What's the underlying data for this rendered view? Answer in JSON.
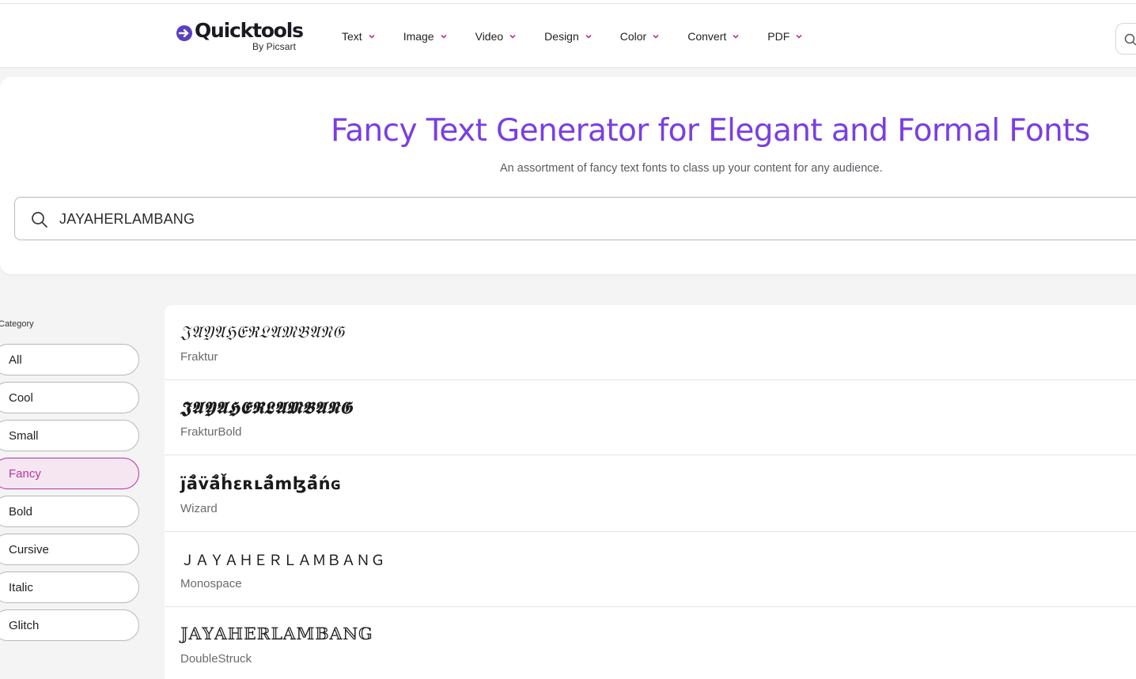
{
  "brand": {
    "name": "Quicktools",
    "sub": "By Picsart",
    "accent": "#7a3ee3",
    "active_color": "#b6349b"
  },
  "nav": {
    "items": [
      {
        "label": "Text"
      },
      {
        "label": "Image"
      },
      {
        "label": "Video"
      },
      {
        "label": "Design"
      },
      {
        "label": "Color"
      },
      {
        "label": "Convert"
      },
      {
        "label": "PDF"
      }
    ]
  },
  "hero": {
    "title": "Fancy Text Generator for Elegant and Formal Fonts",
    "subtitle": "An assortment of fancy text fonts to class up your content for any audience."
  },
  "search": {
    "value": "JAYAHERLAMBANG",
    "icon": "search-icon"
  },
  "categories": {
    "label": "Category",
    "items": [
      {
        "label": "All",
        "active": false
      },
      {
        "label": "Cool",
        "active": false
      },
      {
        "label": "Small",
        "active": false
      },
      {
        "label": "Fancy",
        "active": true
      },
      {
        "label": "Bold",
        "active": false
      },
      {
        "label": "Cursive",
        "active": false
      },
      {
        "label": "Italic",
        "active": false
      },
      {
        "label": "Glitch",
        "active": false
      }
    ]
  },
  "results": [
    {
      "sample": "𝔍𝔄𝔜𝔄ℌ𝔈ℜ𝔏𝔄𝔐𝔅𝔄𝔑𝔊",
      "font": "Fraktur"
    },
    {
      "sample": "𝕵𝕬𝖄𝕬𝕳𝕰𝕽𝕷𝕬𝕸𝕭𝕬𝕹𝕲",
      "font": "FrakturBold"
    },
    {
      "sample": "ȷ̈ä̊v̈ä̊ȟεʀʟä̊mɮä̊ńɢ",
      "font": "Wizard"
    },
    {
      "sample": "ＪＡＹＡＨＥＲＬＡＭＢＡＮＧ",
      "font": "Monospace"
    },
    {
      "sample": "𝕁𝔸𝕐𝔸ℍ𝔼ℝ𝕃𝔸𝕄𝔹𝔸ℕ𝔾",
      "font": "DoubleStruck"
    }
  ]
}
